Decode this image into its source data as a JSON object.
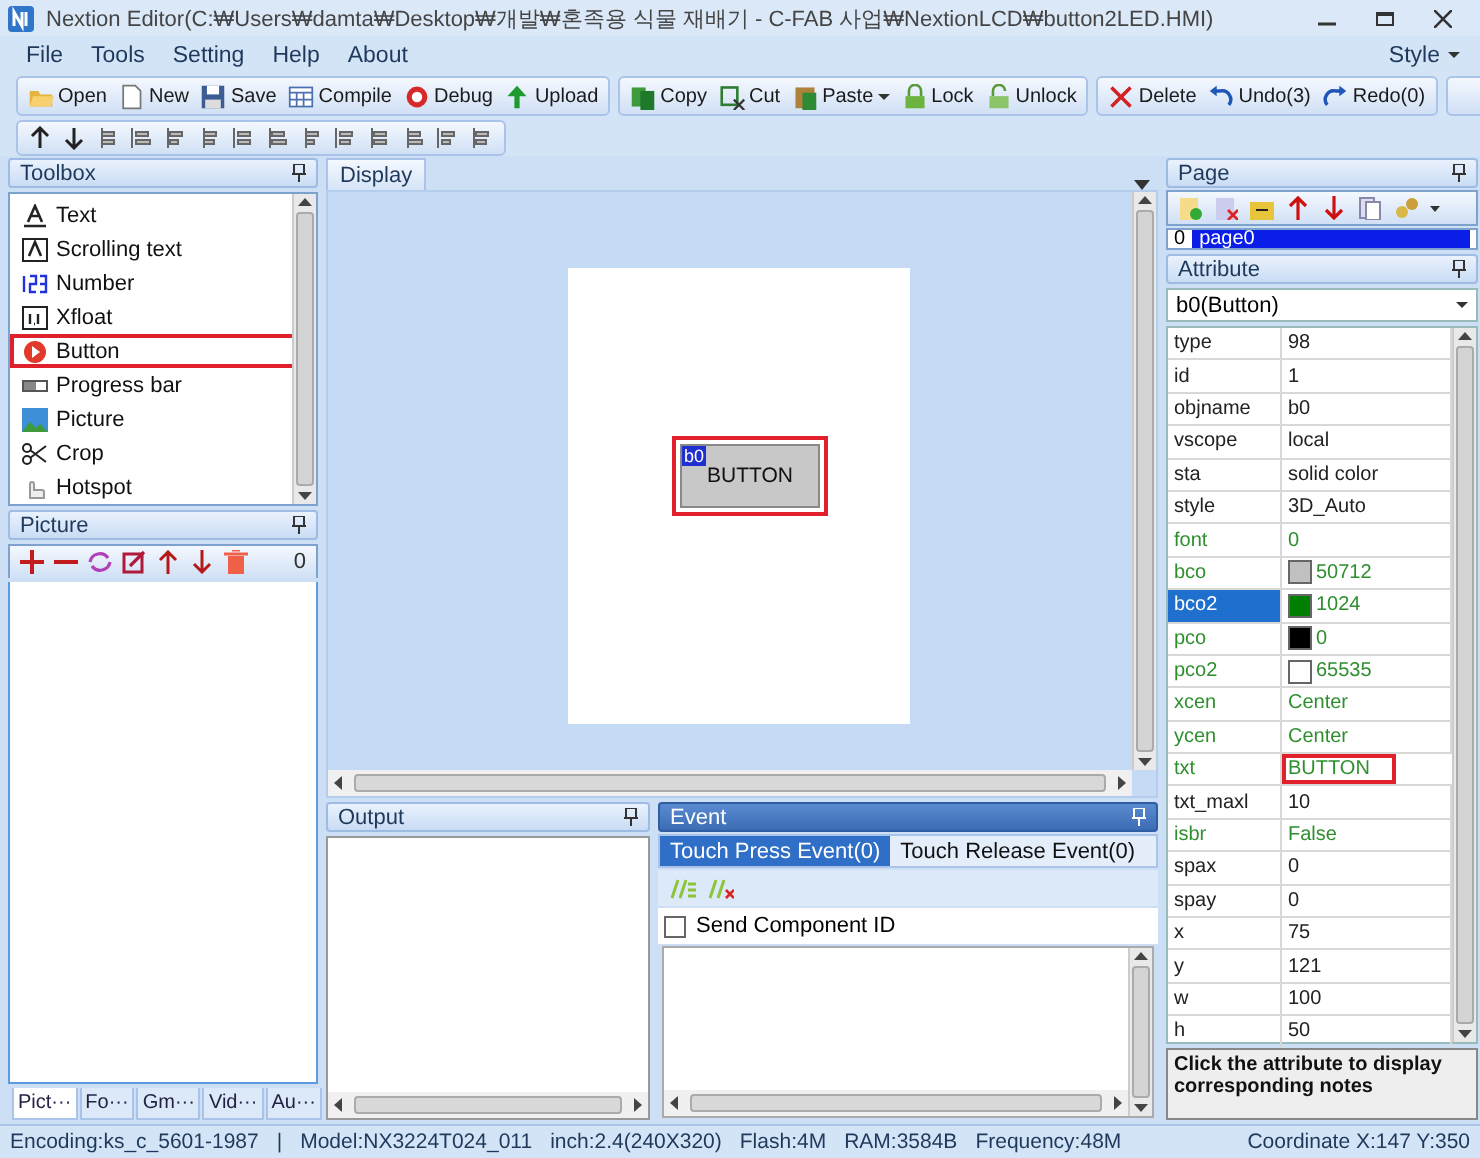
{
  "window": {
    "title": "Nextion  Editor(C:₩Users₩damta₩Desktop₩개발₩혼족용 식물 재배기 - C-FAB 사업₩NextionLCD₩button2LED.HMI)"
  },
  "menu": {
    "items": [
      {
        "label": "File"
      },
      {
        "label": "Tools"
      },
      {
        "label": "Setting"
      },
      {
        "label": "Help"
      },
      {
        "label": "About"
      }
    ],
    "style_label": "Style"
  },
  "toolbar": {
    "groups": [
      [
        {
          "label": "Open"
        },
        {
          "label": "New"
        },
        {
          "label": "Save"
        },
        {
          "label": "Compile"
        },
        {
          "label": "Debug"
        },
        {
          "label": "Upload"
        }
      ],
      [
        {
          "label": "Copy"
        },
        {
          "label": "Cut"
        },
        {
          "label": "Paste"
        },
        {
          "label": "Lock"
        },
        {
          "label": "Unlock"
        }
      ],
      [
        {
          "label": "Delete"
        },
        {
          "label": "Undo(3)"
        },
        {
          "label": "Redo(0)"
        }
      ]
    ]
  },
  "toolbox": {
    "title": "Toolbox",
    "items": [
      {
        "label": "Text",
        "highlighted": false
      },
      {
        "label": "Scrolling text",
        "highlighted": false
      },
      {
        "label": "Number",
        "highlighted": false
      },
      {
        "label": "Xfloat",
        "highlighted": false
      },
      {
        "label": "Button",
        "highlighted": true
      },
      {
        "label": "Progress bar",
        "highlighted": false
      },
      {
        "label": "Picture",
        "highlighted": false
      },
      {
        "label": "Crop",
        "highlighted": false
      },
      {
        "label": "Hotspot",
        "highlighted": false
      }
    ]
  },
  "picture_panel": {
    "title": "Picture",
    "count": "0",
    "tabs": [
      {
        "label": "Pict···",
        "selected": true
      },
      {
        "label": "Fo···",
        "selected": false
      },
      {
        "label": "Gm···",
        "selected": false
      },
      {
        "label": "Vid···",
        "selected": false
      },
      {
        "label": "Au···",
        "selected": false
      }
    ]
  },
  "display": {
    "tab": "Display",
    "component": {
      "id_label": "b0",
      "text": "BUTTON",
      "highlighted": true
    }
  },
  "output": {
    "title": "Output"
  },
  "event": {
    "title": "Event",
    "tabs": [
      {
        "label": "Touch Press Event(0)",
        "selected": true
      },
      {
        "label": "Touch Release Event(0)",
        "selected": false
      }
    ],
    "send_component_id": {
      "label": "Send Component ID",
      "checked": false
    }
  },
  "page": {
    "title": "Page",
    "items": [
      {
        "index": "0",
        "name": "page0",
        "selected": true
      }
    ]
  },
  "attribute": {
    "title": "Attribute",
    "object": "b0(Button)",
    "rows": [
      {
        "name": "type",
        "value": "98",
        "runtime": false,
        "selected": false,
        "highlighted": false
      },
      {
        "name": "id",
        "value": "1",
        "runtime": false,
        "selected": false,
        "highlighted": false
      },
      {
        "name": "objname",
        "value": "b0",
        "runtime": false,
        "selected": false,
        "highlighted": false
      },
      {
        "name": "vscope",
        "value": "local",
        "runtime": false,
        "selected": false,
        "highlighted": false
      },
      {
        "name": "sta",
        "value": "solid color",
        "runtime": false,
        "selected": false,
        "highlighted": false
      },
      {
        "name": "style",
        "value": "3D_Auto",
        "runtime": false,
        "selected": false,
        "highlighted": false
      },
      {
        "name": "font",
        "value": "0",
        "runtime": true,
        "selected": false,
        "highlighted": false
      },
      {
        "name": "bco",
        "value": "50712",
        "runtime": true,
        "selected": false,
        "highlighted": false,
        "color": "#c0c0c0"
      },
      {
        "name": "bco2",
        "value": "1024",
        "runtime": true,
        "selected": true,
        "highlighted": false,
        "color": "#008000"
      },
      {
        "name": "pco",
        "value": "0",
        "runtime": true,
        "selected": false,
        "highlighted": false,
        "color": "#000000"
      },
      {
        "name": "pco2",
        "value": "65535",
        "runtime": true,
        "selected": false,
        "highlighted": false,
        "color": "#ffffff"
      },
      {
        "name": "xcen",
        "value": "Center",
        "runtime": true,
        "selected": false,
        "highlighted": false
      },
      {
        "name": "ycen",
        "value": "Center",
        "runtime": true,
        "selected": false,
        "highlighted": false
      },
      {
        "name": "txt",
        "value": "BUTTON",
        "runtime": true,
        "selected": false,
        "highlighted": true
      },
      {
        "name": "txt_maxl",
        "value": "10",
        "runtime": false,
        "selected": false,
        "highlighted": false
      },
      {
        "name": "isbr",
        "value": "False",
        "runtime": true,
        "selected": false,
        "highlighted": false
      },
      {
        "name": "spax",
        "value": "0",
        "runtime": false,
        "selected": false,
        "highlighted": false
      },
      {
        "name": "spay",
        "value": "0",
        "runtime": false,
        "selected": false,
        "highlighted": false
      },
      {
        "name": "x",
        "value": "75",
        "runtime": false,
        "selected": false,
        "highlighted": false
      },
      {
        "name": "y",
        "value": "121",
        "runtime": false,
        "selected": false,
        "highlighted": false
      },
      {
        "name": "w",
        "value": "100",
        "runtime": false,
        "selected": false,
        "highlighted": false
      },
      {
        "name": "h",
        "value": "50",
        "runtime": false,
        "selected": false,
        "highlighted": false
      }
    ],
    "note": "Click the attribute to display corresponding notes"
  },
  "status_bar": {
    "items": [
      "Encoding:ks_c_5601-1987",
      "|",
      "Model:NX3224T024_011",
      "inch:2.4(240X320)",
      "Flash:4M",
      "RAM:3584B",
      "Frequency:48M",
      "Coordinate X:147  Y:350"
    ]
  }
}
